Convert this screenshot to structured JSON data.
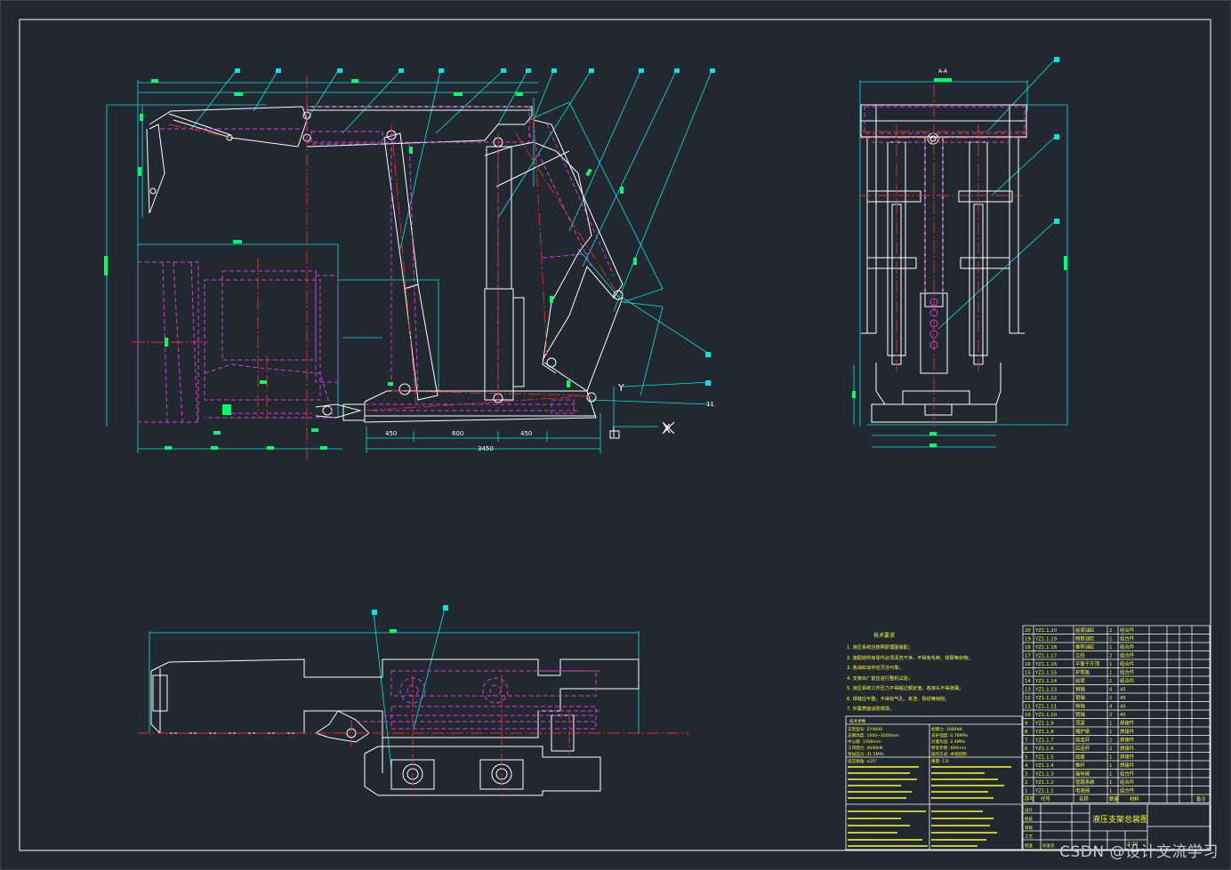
{
  "colors": {
    "background": "#212830",
    "border": "#ffffff",
    "geometry": "#ffffff",
    "dimension": "#00e5e5",
    "hidden": "#d23cd2",
    "center": "#e03030",
    "label": "#00ff66"
  },
  "front_view": {
    "balloons": [
      "15",
      "14",
      "13",
      "8",
      "9",
      "7",
      "5",
      "6",
      "4",
      "1",
      "3",
      "2",
      "10",
      "11",
      "11"
    ],
    "dims": {
      "d1": "450",
      "d2": "600",
      "d3": "450",
      "total": "3450"
    },
    "axis_x": "X",
    "axis_y": "Y"
  },
  "side_view": {
    "title": "A-A",
    "balloons": [
      "16",
      "17",
      "18"
    ]
  },
  "plan_view": {
    "balloons": [
      "19",
      "20"
    ]
  },
  "notes": {
    "heading": "技术要求",
    "items": [
      "1. 液压系统应按照原理图装配；",
      "2. 装配前所有零件必须清洗干净，不得有毛刺、铁屑等杂物；",
      "3. 各油缸动作应灵活可靠；",
      "4. 支架出厂前应进行整机试验；",
      "5. 液压系统工作压力不得超过额定值，各接头不得渗漏；",
      "6. 焊缝应平整，不得有气孔、夹渣、裂纹等缺陷；",
      "7. 外露表面涂防锈漆。"
    ]
  },
  "parameters": {
    "heading": "技术参数",
    "left_col": [
      "支架型号: ZY4000",
      "支撑高度: 1600~3500mm",
      "中心距: 1500mm",
      "工作阻力: 4000kN",
      "泵站压力: 31.5MPa",
      "适应倾角: ≤25°"
    ],
    "right_col": [
      "初撑力: 3000kN",
      "支护强度: 0.78MPa",
      "对底比压: 2.4MPa",
      "移架步距: 600mm",
      "操作方式: 本架控制",
      "重量: 12t"
    ]
  },
  "bom": {
    "rows": [
      [
        "20",
        "YZ1.1.20",
        "前梁油缸",
        "2",
        "组合件"
      ],
      [
        "19",
        "YZ1.1.19",
        "侧推油缸",
        "2",
        "组合件"
      ],
      [
        "18",
        "YZ1.1.18",
        "推移油缸",
        "1",
        "组合件"
      ],
      [
        "17",
        "YZ1.1.17",
        "立柱",
        "2",
        "组合件"
      ],
      [
        "16",
        "YZ1.1.16",
        "平衡千斤顶",
        "1",
        "组合件"
      ],
      [
        "15",
        "YZ1.1.15",
        "护帮板",
        "1",
        "组合件"
      ],
      [
        "14",
        "YZ1.1.14",
        "前梁",
        "1",
        "组合件"
      ],
      [
        "13",
        "YZ1.1.13",
        "销轴",
        "4",
        "45"
      ],
      [
        "12",
        "YZ1.1.12",
        "销轴",
        "2",
        "45"
      ],
      [
        "11",
        "YZ1.1.11",
        "销轴",
        "4",
        "45"
      ],
      [
        "10",
        "YZ1.1.10",
        "销轴",
        "2",
        "45"
      ],
      [
        "9",
        "YZ1.1.9",
        "顶梁",
        "1",
        "焊接件"
      ],
      [
        "8",
        "YZ1.1.8",
        "掩护梁",
        "1",
        "焊接件"
      ],
      [
        "7",
        "YZ1.1.7",
        "前连杆",
        "2",
        "焊接件"
      ],
      [
        "6",
        "YZ1.1.6",
        "后连杆",
        "2",
        "焊接件"
      ],
      [
        "5",
        "YZ1.1.5",
        "底座",
        "1",
        "焊接件"
      ],
      [
        "4",
        "YZ1.1.4",
        "推杆",
        "1",
        "焊接件"
      ],
      [
        "3",
        "YZ1.1.3",
        "操纵阀",
        "1",
        "组合件"
      ],
      [
        "2",
        "YZ1.1.2",
        "管路系统",
        "1",
        "组合件"
      ],
      [
        "1",
        "YZ1.1.1",
        "电液阀",
        "1",
        "组合件"
      ]
    ],
    "header": [
      "序号",
      "代号",
      "名称",
      "数量",
      "材料",
      "备注"
    ]
  },
  "title_block": {
    "drawing_title": "液压支架总装图",
    "scale": "1:10",
    "cells": [
      "设计",
      "校核",
      "审核",
      "工艺",
      "批准",
      "标准化"
    ]
  },
  "watermark": "CSDN @设计交流学习"
}
